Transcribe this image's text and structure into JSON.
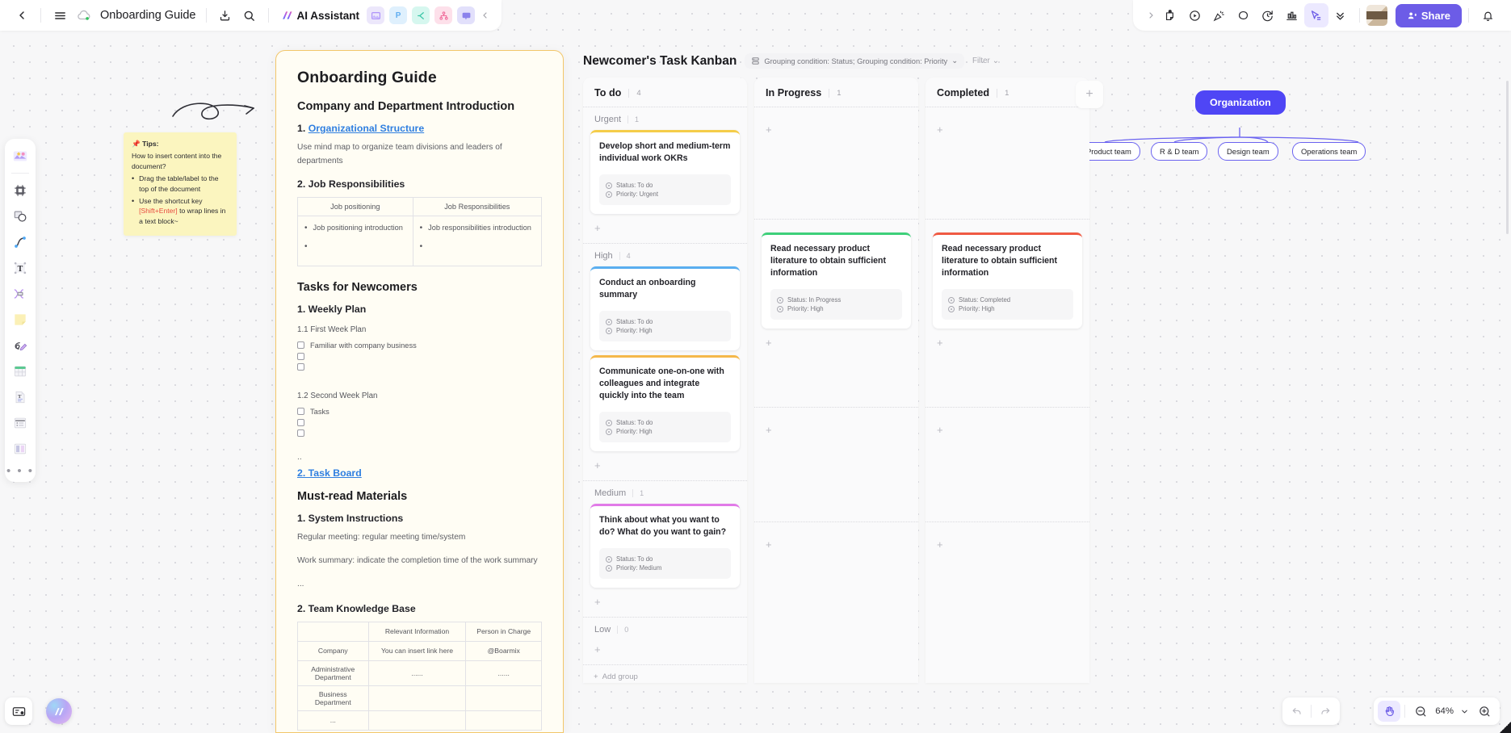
{
  "topbar": {
    "back_icon": "chevron-left-icon",
    "menu_icon": "hamburger-menu-icon",
    "cloud_icon": "cloud-sync-icon",
    "doc_title": "Onboarding Guide",
    "download_icon": "download-icon",
    "search_icon": "search-icon",
    "ai_assistant_label": "AI Assistant",
    "apps": [
      {
        "name": "image-app-icon",
        "glyph": "▲"
      },
      {
        "name": "presentation-app-icon",
        "glyph": "P"
      },
      {
        "name": "flowchart-app-icon",
        "glyph": "❮"
      },
      {
        "name": "mindmap-app-icon",
        "glyph": "⚬"
      },
      {
        "name": "comment-app-icon",
        "glyph": "▬"
      }
    ],
    "collapse_icon": "chevron-left-icon",
    "right_expand_icon": "chevron-right-icon",
    "right_tools": [
      {
        "name": "sticky-note-icon"
      },
      {
        "name": "media-play-icon"
      },
      {
        "name": "confetti-icon"
      },
      {
        "name": "shape-blob-icon"
      },
      {
        "name": "timer-icon"
      },
      {
        "name": "chart-icon"
      },
      {
        "name": "cursor-select-icon"
      },
      {
        "name": "chevron-double-down-icon"
      }
    ],
    "share_label": "Share",
    "share_icon": "person-add-icon",
    "notification_icon": "bell-icon",
    "accent_color": "#6c5ce7"
  },
  "left_toolbar": {
    "items": [
      {
        "name": "templates-tool",
        "label": "Templates"
      },
      {
        "name": "frame-tool",
        "label": "Frame"
      },
      {
        "name": "shapes-tool",
        "label": "Shapes"
      },
      {
        "name": "connector-tool",
        "label": "Connector"
      },
      {
        "name": "text-tool",
        "label": "Text"
      },
      {
        "name": "mindmap-tool",
        "label": "Mind map"
      },
      {
        "name": "sticky-note-tool",
        "label": "Sticky note"
      },
      {
        "name": "pen-tool",
        "label": "Pen"
      },
      {
        "name": "table-tool",
        "label": "Table"
      },
      {
        "name": "document-tool",
        "label": "Document"
      },
      {
        "name": "list-tool",
        "label": "List"
      },
      {
        "name": "kanban-tool",
        "label": "Kanban"
      }
    ],
    "more_label": "• • •"
  },
  "tips": {
    "title": "Tips:",
    "question": "How to insert content into the document?",
    "bullets": [
      {
        "text": "Drag the table/label to the top of the document"
      }
    ],
    "bullet2_pre": "Use the shortcut key ",
    "bullet2_key": "[Shift+Enter]",
    "bullet2_post": " to wrap lines in a text block~",
    "key_color": "#e8493f"
  },
  "document": {
    "title": "Onboarding Guide",
    "section1_heading": "Company and Department Introduction",
    "item1_prefix": "1. ",
    "item1_link": "Organizational Structure",
    "item1_desc": "Use mind map to organize team divisions and leaders of departments",
    "item2_heading": "2. Job Responsibilities",
    "job_table": {
      "headers": [
        "Job positioning",
        "Job Responsibilities"
      ],
      "cells": [
        "Job positioning introduction",
        "Job responsibilities introduction"
      ]
    },
    "section2_heading": "Tasks for Newcomers",
    "weekly_plan_heading": "1. Weekly Plan",
    "first_week_label": "1.1 First Week Plan",
    "first_week_tasks": [
      "Familiar with company business",
      "",
      ""
    ],
    "second_week_label": "1.2 Second Week Plan",
    "second_week_tasks": [
      "Tasks",
      "",
      ""
    ],
    "ellipsis": "..",
    "task_board_link": "2. Task Board",
    "section3_heading": "Must-read Materials",
    "sys_heading": "1. System Instructions",
    "sys_line1": "Regular meeting: regular meeting time/system",
    "sys_line2": "Work summary: indicate the completion time of the work summary",
    "sys_ellipsis": "...",
    "kb_heading": "2. Team Knowledge Base",
    "kb_table": {
      "headers": [
        "",
        "Relevant Information",
        "Person in Charge"
      ],
      "rows": [
        [
          "Company",
          "You can insert link here",
          "@Boarmix"
        ],
        [
          "Administrative Department",
          "......",
          "......"
        ],
        [
          "Business Department",
          "",
          ""
        ],
        [
          "...",
          "",
          ""
        ]
      ]
    }
  },
  "kanban": {
    "title": "Newcomer's Task Kanban",
    "grouping_icon": "grouping-icon",
    "grouping_label": "Grouping condition: Status; Grouping condition: Priority",
    "grouping_caret": "⌄",
    "filter_label": "Filter",
    "filter_caret": "⌄",
    "add_column_label": "+",
    "add_group_label": "Add group",
    "add_card_label": "+",
    "columns": [
      {
        "name": "To do",
        "count": "4",
        "groups": [
          {
            "name": "Urgent",
            "count": "1",
            "cards": [
              {
                "title": "Develop short and medium-term individual work OKRs",
                "status_label": "Status: To do",
                "priority_label": "Priority: Urgent",
                "accent": "#f5cd4a"
              }
            ]
          },
          {
            "name": "High",
            "count": "4",
            "cards": [
              {
                "title": "Conduct an onboarding summary",
                "status_label": "Status: To do",
                "priority_label": "Priority: High",
                "accent": "#5aaef0"
              },
              {
                "title": "Communicate one-on-one with colleagues and integrate quickly into the team",
                "status_label": "Status: To do",
                "priority_label": "Priority: High",
                "accent": "#f5b84a"
              }
            ]
          },
          {
            "name": "Medium",
            "count": "1",
            "cards": [
              {
                "title": "Think about what you want to do? What do you want to gain?",
                "status_label": "Status: To do",
                "priority_label": "Priority: Medium",
                "accent": "#e17ae8"
              }
            ]
          },
          {
            "name": "Low",
            "count": "0",
            "cards": []
          }
        ]
      },
      {
        "name": "In Progress",
        "count": "1",
        "groups": [
          {
            "name": "",
            "count": "",
            "cards": []
          },
          {
            "name": "",
            "count": "",
            "cards": [
              {
                "title": "Read necessary product literature to obtain sufficient information",
                "status_label": "Status: In Progress",
                "priority_label": "Priority: High",
                "accent": "#3ed07a"
              }
            ]
          },
          {
            "name": "",
            "count": "",
            "cards": []
          },
          {
            "name": "",
            "count": "",
            "cards": []
          }
        ]
      },
      {
        "name": "Completed",
        "count": "1",
        "groups": [
          {
            "name": "",
            "count": "",
            "cards": []
          },
          {
            "name": "",
            "count": "",
            "cards": [
              {
                "title": "Read necessary product literature to obtain sufficient information",
                "status_label": "Status: Completed",
                "priority_label": "Priority: High",
                "accent": "#f05a43"
              }
            ]
          },
          {
            "name": "",
            "count": "",
            "cards": []
          },
          {
            "name": "",
            "count": "",
            "cards": []
          }
        ]
      }
    ]
  },
  "mindmap": {
    "root": "Organization",
    "root_color": "#4f46f5",
    "leaves": [
      "Product team",
      "R & D team",
      "Design team",
      "Operations team"
    ]
  },
  "bottom": {
    "card_icon": "card-settings-icon",
    "ai_orb_icon": "ai-orb-icon",
    "undo_icon": "undo-icon",
    "redo_icon": "redo-icon",
    "hand_icon": "hand-tool-icon",
    "zoom_out_icon": "zoom-out-icon",
    "zoom_level": "64%",
    "zoom_caret": "⌄",
    "zoom_in_icon": "zoom-in-icon"
  }
}
